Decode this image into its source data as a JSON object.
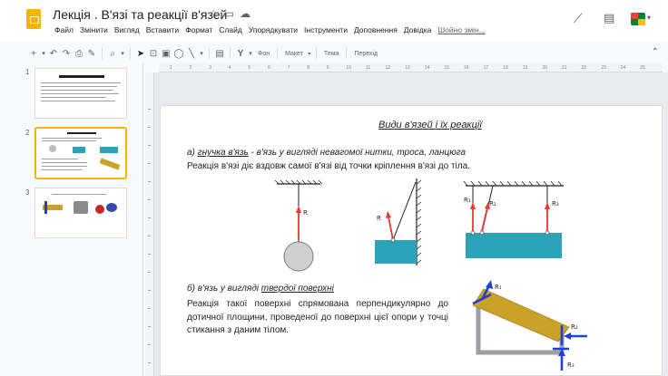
{
  "header": {
    "doc_title": "Лекція . В'язі та реакції в'язей",
    "menu": [
      "Файл",
      "Змінити",
      "Вигляд",
      "Вставити",
      "Формат",
      "Слайд",
      "Упорядкувати",
      "Інструменти",
      "Доповнення",
      "Довідка",
      "Шойно змін..."
    ]
  },
  "toolbar": {
    "background_label": "Фон",
    "layout_label": "Макет",
    "theme_label": "Тема",
    "transition_label": "Перехід"
  },
  "filmstrip": {
    "slides": [
      {
        "number": "1",
        "title": "Лекція . В'язі та реакції в'язей"
      },
      {
        "number": "2",
        "title": "Види в'язей і їх реакції"
      },
      {
        "number": "3"
      }
    ],
    "selected_index": 1
  },
  "ruler": {
    "marks": [
      "1",
      "2",
      "3",
      "4",
      "5",
      "6",
      "7",
      "8",
      "9",
      "10",
      "11",
      "12",
      "13",
      "14",
      "15",
      "16",
      "17",
      "18",
      "19",
      "20",
      "21",
      "22",
      "23",
      "24",
      "25"
    ]
  },
  "slide": {
    "heading": "Види в'язей і їх реакції",
    "section_a_prefix": "а) ",
    "section_a_term": "гнучка в'язь",
    "section_a_rest": " - в'язь у вигляді невагомої нитки, троса, ланцюга",
    "section_a_desc": "Реакція в'язі діє вздовж самої в'язі від точки кріплення в'язі до тіла.",
    "section_b_prefix": "б) в'язь у вигляді ",
    "section_b_term": "твердої поверхні",
    "section_b_desc": "Реакція такої поверхні спрямована перпендикулярно до дотичної площини, проведеної до поверхні цієї опори у точці стикання з даним тілом.",
    "labels": {
      "r": "R",
      "r1": "R₁",
      "r2": "R₂",
      "r3": "R₃"
    }
  },
  "colors": {
    "accent": "#f4b400",
    "force_red": "#e53935",
    "force_blue": "#1e3fd8",
    "water": "#2aa3b8",
    "bar": "#c9a227"
  }
}
